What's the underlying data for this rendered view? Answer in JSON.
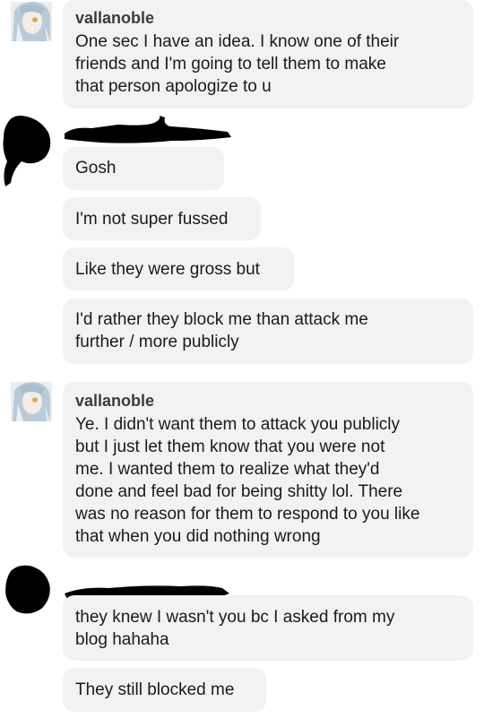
{
  "messages": [
    {
      "sender": "vallanoble",
      "text": "One sec I have an idea. I know one of their\nfriends and I'm going to tell them to make\nthat person apologize to u"
    },
    {
      "text": "Gosh"
    },
    {
      "text": "I'm not super fussed"
    },
    {
      "text": "Like they were gross but"
    },
    {
      "text": "I'd rather they block me than attack me\nfurther / more publicly"
    },
    {
      "sender": "vallanoble",
      "text": "Ye. I didn't want them to attack you publicly\nbut I just let them know that you were not\nme. I wanted them to realize what they'd\ndone and feel bad for being shitty lol. There\nwas no reason for them to respond to you like\nthat when you did nothing wrong"
    },
    {
      "text": "they knew I wasn't you bc I asked from my\nblog hahaha"
    },
    {
      "text": "They still blocked me"
    }
  ],
  "colors": {
    "bubble": "#f2f2f3",
    "text": "#1a1a1a",
    "redaction": "#000000"
  },
  "icons": {
    "sender_avatar": "anime-avatar-icon",
    "redacted_avatar": "redacted-scribble"
  }
}
